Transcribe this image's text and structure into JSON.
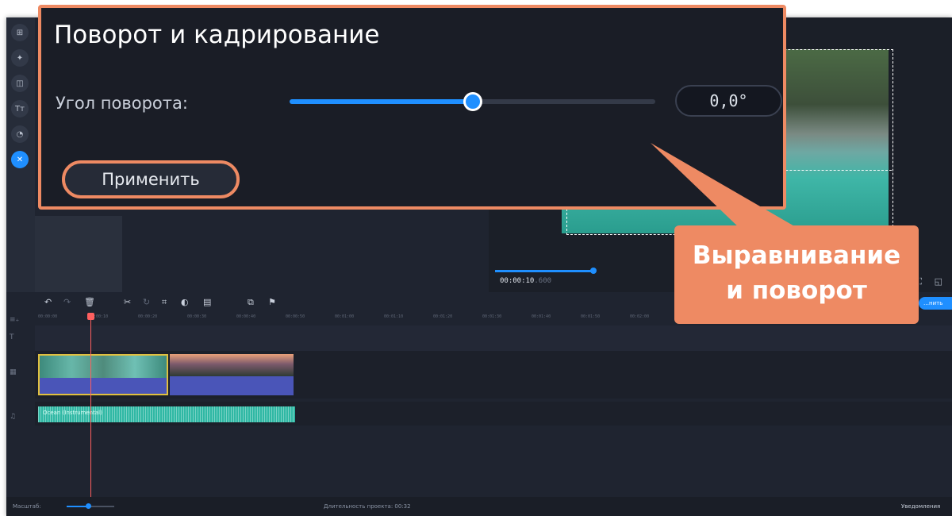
{
  "rotation_panel": {
    "title": "Поворот и кадрирование",
    "angle_label": "Угол поворота:",
    "angle_value": "0,0°",
    "slider_level": 0.5,
    "apply_label": "Применить"
  },
  "callout": {
    "line1": "Выравнивание",
    "line2": "и поворот"
  },
  "preview": {
    "timecode": "00:00:10",
    "timecode_ms": ".600"
  },
  "timeline": {
    "export_label": "…нить",
    "ruler": [
      "00:00:00",
      "00:00:10",
      "00:00:20",
      "00:00:30",
      "00:00:40",
      "00:00:50",
      "00:01:00",
      "00:01:10",
      "00:01:20",
      "00:01:30",
      "00:01:40",
      "00:01:50",
      "00:02:00"
    ],
    "audio_clip_name": "Ocean (Instrumental)"
  },
  "status_bar": {
    "scale_label": "Масштаб:",
    "duration_label": "Длительность проекта: 00:32",
    "notifications_label": "Уведомления"
  },
  "accent": "#1f8fff",
  "highlight": "#ee8a63"
}
